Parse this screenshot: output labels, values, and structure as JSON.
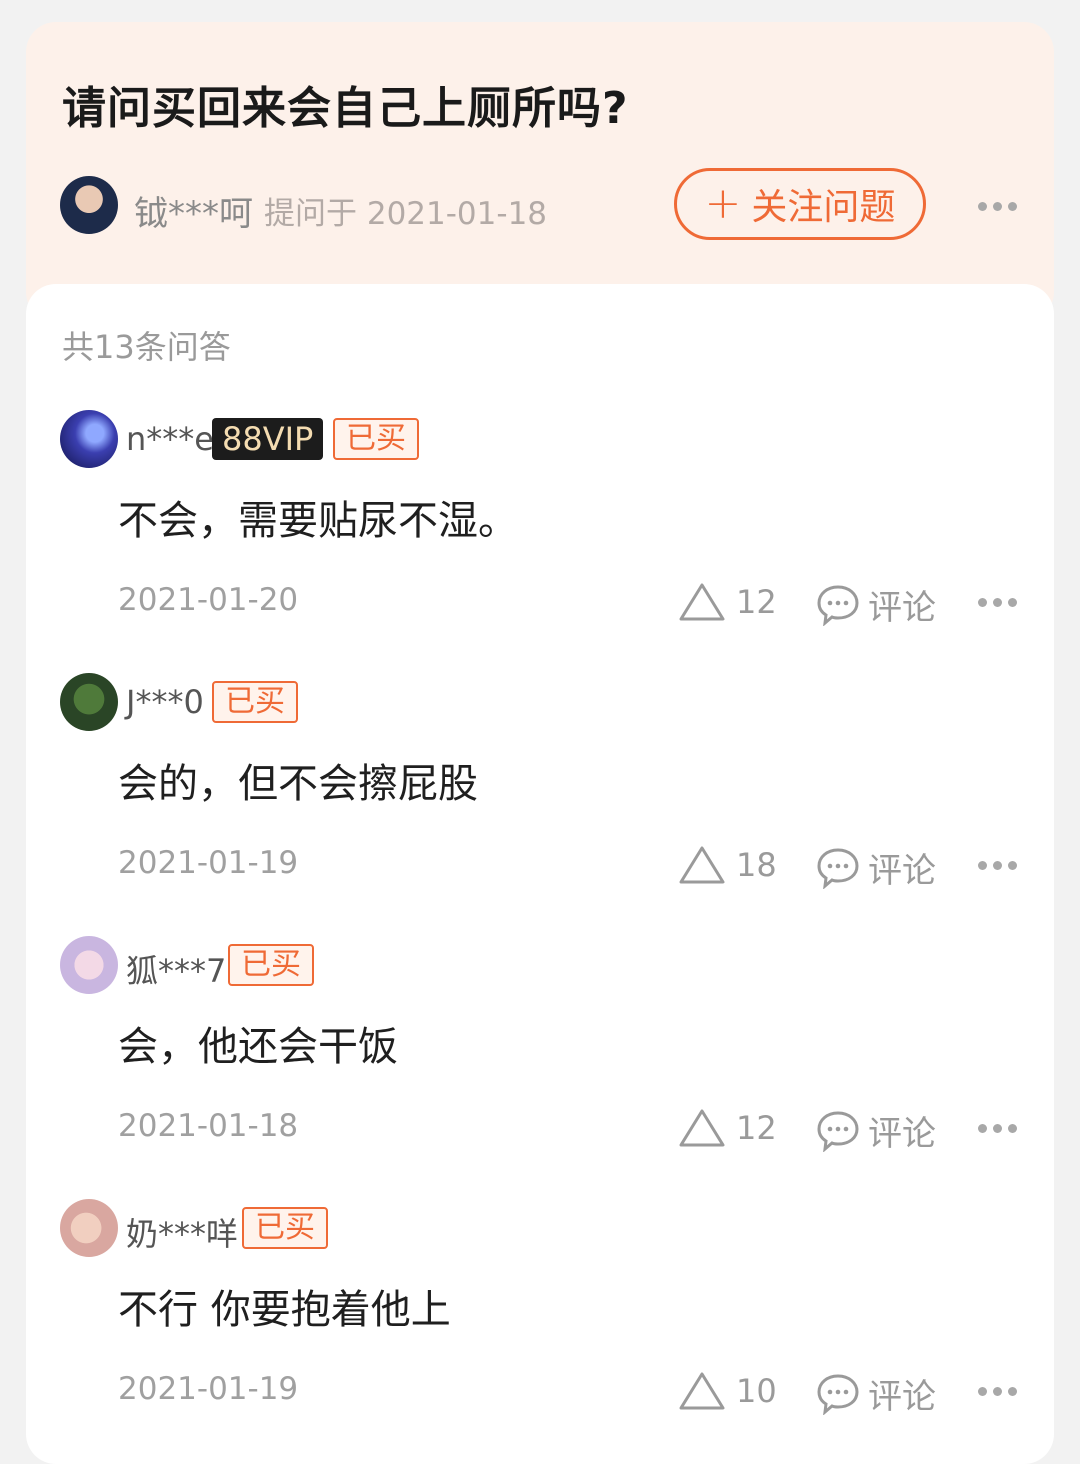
{
  "question": {
    "title": "请问买回来会自己上厕所吗?",
    "asker_name": "钺***呵",
    "asked_at": "提问于 2021-01-18",
    "follow_label": "关注问题",
    "follow_icon": "plus-icon"
  },
  "answer_count": "共13条问答",
  "comment_label": "评论",
  "answers": [
    {
      "user": "n***e",
      "vip": "88VIP",
      "bought": "已买",
      "text": "不会，需要贴尿不湿。",
      "date": "2021-01-20",
      "likes": "12"
    },
    {
      "user": "J***0",
      "bought": "已买",
      "text": "会的，但不会擦屁股",
      "date": "2021-01-19",
      "likes": "18"
    },
    {
      "user": "狐***7",
      "bought": "已买",
      "text": "会，他还会干饭",
      "date": "2021-01-18",
      "likes": "12"
    },
    {
      "user": "奶***咩",
      "bought": "已买",
      "text": "不行 你要抱着他上",
      "date": "2021-01-19",
      "likes": "10"
    }
  ],
  "colors": {
    "accent": "#ef6a36",
    "header_bg": "#fdf1ea",
    "vip_bg": "#1c1c1c",
    "vip_text": "#f4dcb1"
  }
}
